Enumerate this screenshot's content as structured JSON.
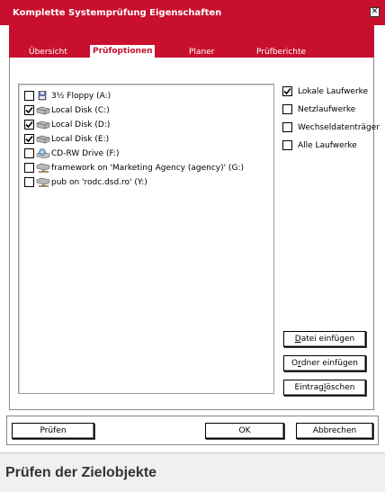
{
  "window": {
    "title": "Komplette Systemprüfung Eigenschaften",
    "close_glyph": "✕"
  },
  "tabs": [
    {
      "label": "Übersicht",
      "active": false
    },
    {
      "label": "Prüfoptionen",
      "active": true
    },
    {
      "label": "Planer",
      "active": false
    },
    {
      "label": "Prüfberichte",
      "active": false
    }
  ],
  "drives": [
    {
      "label": "3½ Floppy (A:)",
      "checked": false,
      "icon": "floppy-drive-icon"
    },
    {
      "label": "Local Disk (C:)",
      "checked": true,
      "icon": "hard-disk-icon"
    },
    {
      "label": "Local Disk (D:)",
      "checked": true,
      "icon": "hard-disk-icon"
    },
    {
      "label": "Local Disk (E:)",
      "checked": true,
      "icon": "hard-disk-icon"
    },
    {
      "label": "CD-RW Drive (F:)",
      "checked": false,
      "icon": "cd-drive-icon"
    },
    {
      "label": "framework on 'Marketing Agency (agency)' (G:)",
      "checked": false,
      "icon": "network-drive-icon"
    },
    {
      "label": "pub on 'rodc.dsd.ro' (Y:)",
      "checked": false,
      "icon": "network-drive-icon"
    }
  ],
  "drive_types": [
    {
      "label": "Lokale Laufwerke",
      "checked": true
    },
    {
      "label": "Netzlaufwerke",
      "checked": false
    },
    {
      "label": "Wechseldatenträger",
      "checked": false
    },
    {
      "label": "Alle Laufwerke",
      "checked": false
    }
  ],
  "side_buttons": {
    "add_file": {
      "mnemonic": "D",
      "rest": "atei einfügen"
    },
    "add_folder": {
      "pre": "O",
      "mnemonic": "r",
      "rest": "dner einfügen"
    },
    "delete_entry": {
      "pre": "Eintrag ",
      "mnemonic": "l",
      "rest": "öschen"
    }
  },
  "footer": {
    "scan_label": "Prüfen",
    "ok_label": "OK",
    "cancel_label": "Abbrechen"
  },
  "caption": "Prüfen der Zielobjekte",
  "colors": {
    "accent": "#c8102e",
    "check": "#000000"
  }
}
